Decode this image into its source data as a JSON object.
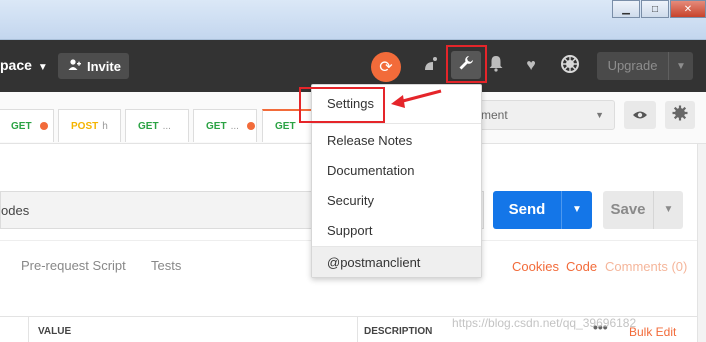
{
  "window": {
    "minimize": "▁",
    "maximize": "□",
    "close": "✕"
  },
  "header": {
    "workspace_label": "pace",
    "invite_label": "Invite",
    "upgrade_label": "Upgrade"
  },
  "tabs": [
    {
      "method": "GET",
      "rest": "",
      "dot": true
    },
    {
      "method": "POST",
      "rest": "h",
      "dot": false
    },
    {
      "method": "GET",
      "rest": "...",
      "dot": false
    },
    {
      "method": "GET",
      "rest": "...",
      "dot": true
    },
    {
      "method": "GET",
      "rest": "",
      "dot": false
    }
  ],
  "environment": {
    "label": "ment"
  },
  "url": {
    "value": "odes"
  },
  "send": {
    "label": "Send"
  },
  "save": {
    "label": "Save"
  },
  "request_tabs": {
    "pre_request": "Pre-request Script",
    "tests": "Tests",
    "cookies": "Cookies",
    "code": "Code",
    "comments": "Comments (0)"
  },
  "table": {
    "value_col": "VALUE",
    "description_col": "DESCRIPTION",
    "bulk_edit": "Bulk Edit",
    "more": "•••"
  },
  "menu": {
    "items": [
      {
        "label": "Settings"
      },
      {
        "label": "Release Notes"
      },
      {
        "label": "Documentation"
      },
      {
        "label": "Security"
      },
      {
        "label": "Support"
      },
      {
        "label": "@postmanclient"
      }
    ]
  },
  "watermark": "https://blog.csdn.net/qq_39696182",
  "colors": {
    "accent": "#f26b3a",
    "send": "#1476e8",
    "annotation": "#e5252a",
    "header_bg": "#333333"
  }
}
